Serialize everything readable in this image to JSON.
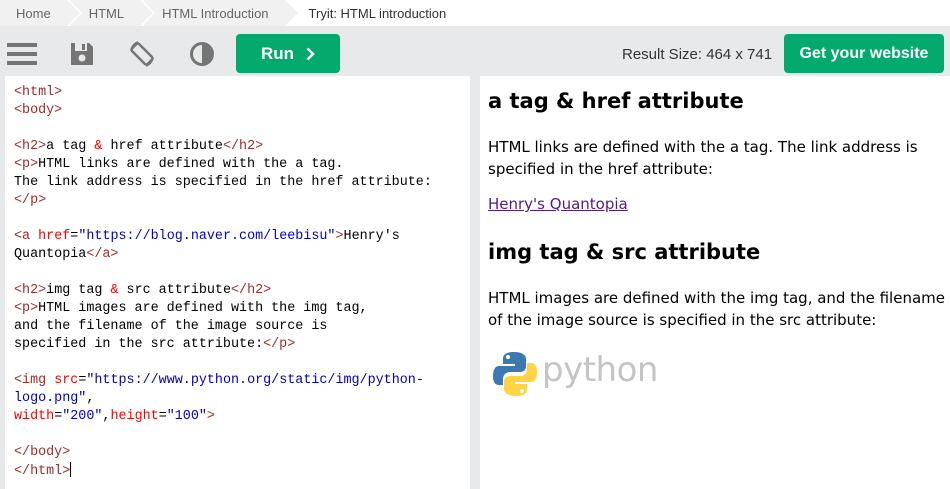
{
  "breadcrumb": [
    "Home",
    "HTML",
    "HTML Introduction",
    "Tryit: HTML introduction"
  ],
  "toolbar": {
    "icons": [
      "menu-icon",
      "save-icon",
      "rotate-icon",
      "theme-contrast-icon"
    ],
    "run_label": "Run",
    "result_size": "Result Size: 464 x 741",
    "get_website_label": "Get your website"
  },
  "editor": {
    "lines": [
      "<html>",
      "<body>",
      "",
      "<h2>a tag & href attribute</h2>",
      "<p>HTML links are defined with the a tag.",
      "The link address is specified in the href attribute:",
      "</p>",
      "",
      "<a href=\"https://blog.naver.com/leebisu\">Henry's",
      "Quantopia</a>",
      "",
      "<h2>img tag & src attribute</h2>",
      "<p>HTML images are defined with the img tag,",
      "and the filename of the image source is",
      "specified in the src attribute:</p>",
      "",
      "<img src=\"https://www.python.org/static/img/python-",
      "logo.png\",",
      "width=\"200\",height=\"100\">",
      "",
      "</body>",
      "</html>"
    ]
  },
  "result": {
    "heading1": "a tag & href attribute",
    "para1_line1": "HTML links are defined with the a tag. The link address is",
    "para1_line2": "specified in the href attribute:",
    "link_text": "Henry's Quantopia",
    "heading2": "img tag & src attribute",
    "para2_line1": "HTML images are defined with the img tag, and the filename",
    "para2_line2": "of the image source is specified in the src attribute:",
    "logo_text": "python"
  }
}
